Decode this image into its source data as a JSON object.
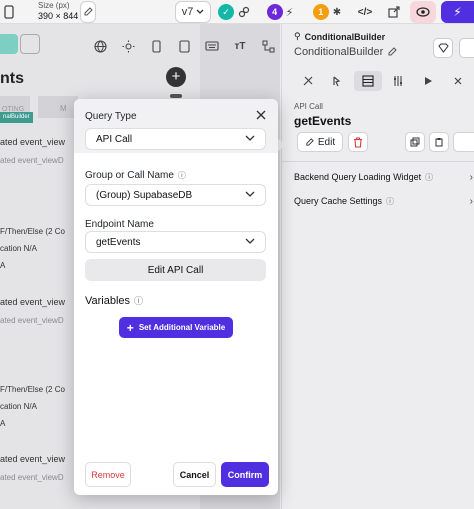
{
  "toolbar": {
    "size_label": "Size (px)",
    "size_value": "390 × 844",
    "version": "v7",
    "badge_four": "4",
    "badge_one": "1",
    "code_glyph": "</>"
  },
  "canvas": {
    "page_title": "nts",
    "tab_left": "OTING",
    "tab_right": "M",
    "chip": "nalBuilder",
    "rows": [
      "ated event_view",
      "ated event_viewD",
      "F/Then/Else (2 Co",
      "cation N/A",
      "A",
      "ated event_view",
      "ated event_viewD",
      "F/Then/Else (2 Co",
      "cation N/A",
      "A",
      "ated event_view",
      "ated event_viewD"
    ]
  },
  "right_panel": {
    "component_type": "ConditionalBuilder",
    "component_name": "ConditionalBuilder",
    "section_label": "API Call",
    "query_name": "getEvents",
    "edit_label": "Edit",
    "backend_loading": "Backend Query Loading Widget",
    "cache_settings": "Query Cache Settings"
  },
  "modal": {
    "query_type_label": "Query Type",
    "query_type_value": "API Call",
    "group_label": "Group or Call Name",
    "group_value": "(Group) SupabaseDB",
    "endpoint_label": "Endpoint Name",
    "endpoint_value": "getEvents",
    "edit_api_call": "Edit API Call",
    "variables_label": "Variables",
    "set_variable": "Set Additional Variable",
    "remove": "Remove",
    "cancel": "Cancel",
    "confirm": "Confirm"
  },
  "colors": {
    "accent": "#4f2fe0",
    "remove_red": "#d93a3a",
    "teal_badge": "#14b8a6",
    "purple_badge": "#6d28d9",
    "orange_badge": "#f59e0b"
  }
}
